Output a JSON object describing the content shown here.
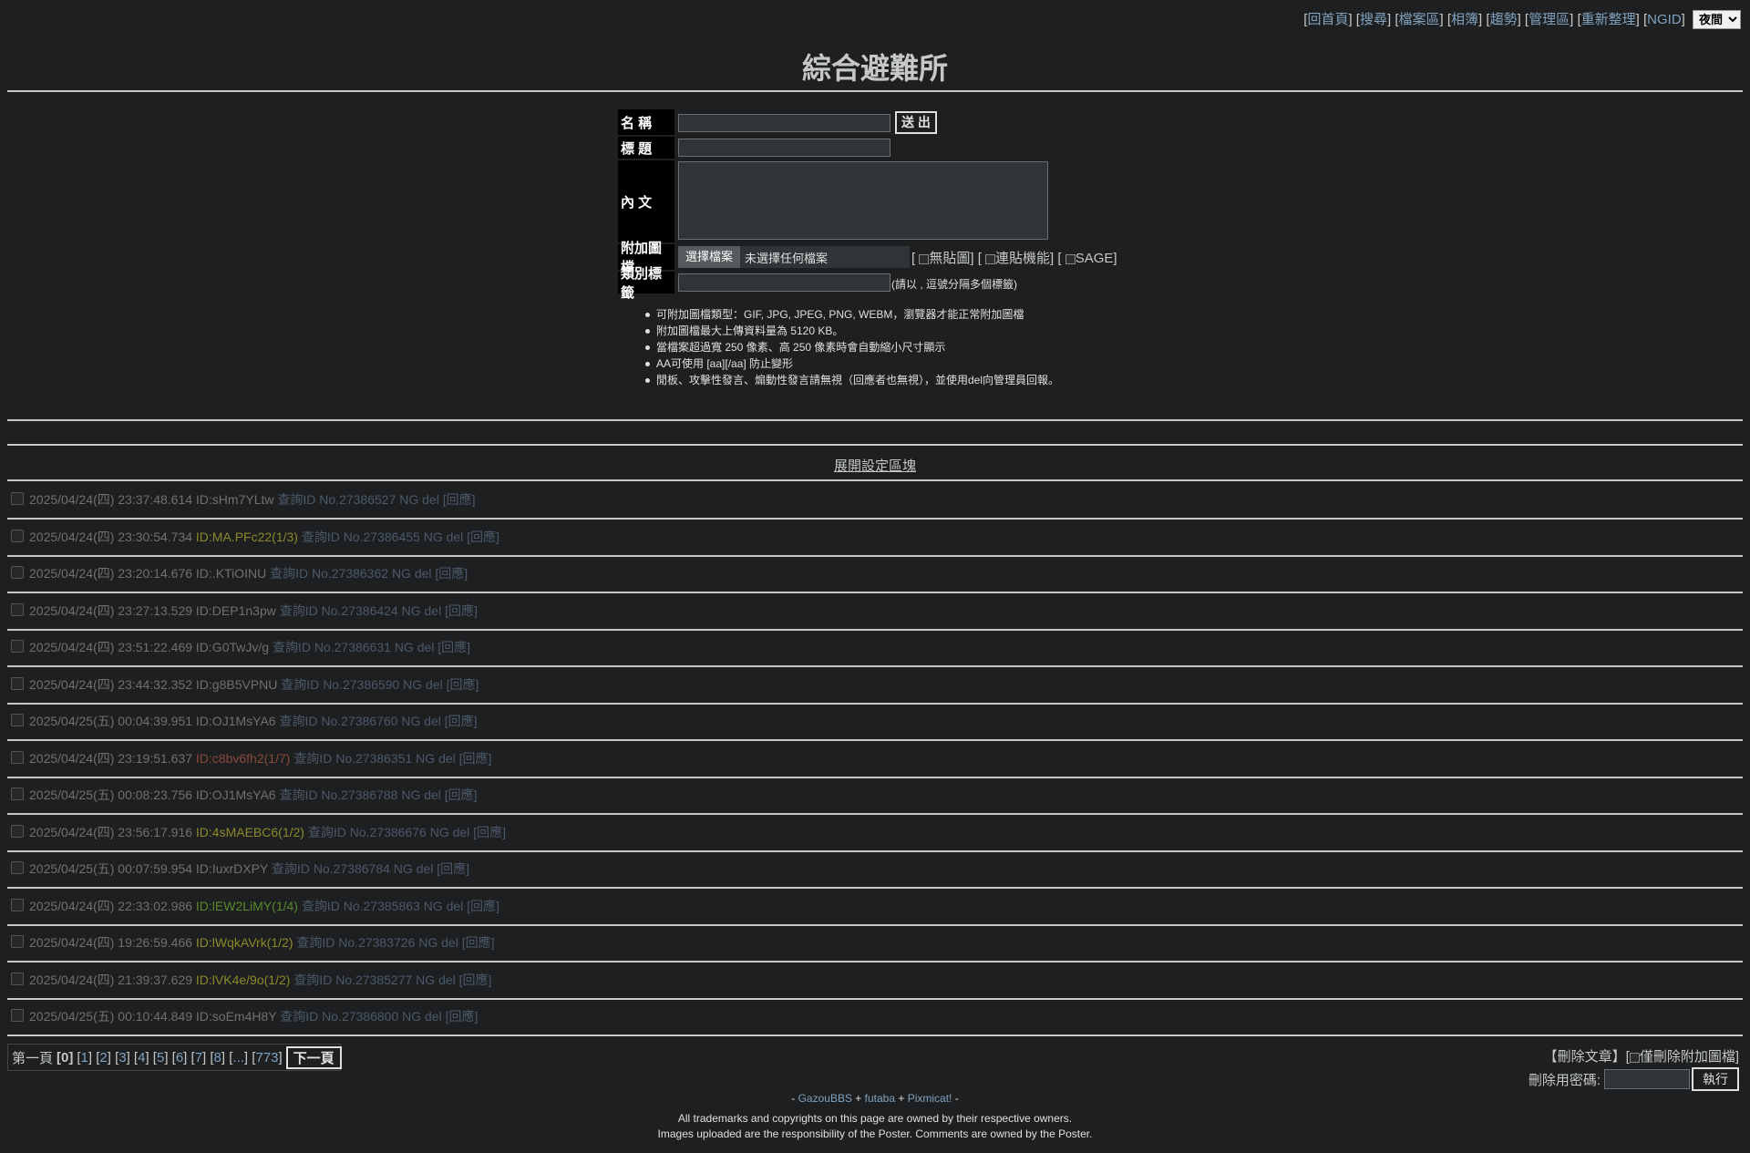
{
  "topnav": {
    "items": [
      "回首頁",
      "搜尋",
      "檔案區",
      "相簿",
      "趨勢",
      "管理區",
      "重新整理",
      "NGID"
    ],
    "mode": "夜間"
  },
  "title": "綜合避難所",
  "form": {
    "name_label": "名 稱",
    "subject_label": "標 題",
    "content_label": "內 文",
    "attach_label": "附加圖檔",
    "tag_label": "類別標籤",
    "submit": "送 出",
    "choose_file": "選擇檔案",
    "no_file": "未選擇任何檔案",
    "opt_noimg": "無貼圖",
    "opt_link": "連貼機能",
    "opt_sage": "SAGE",
    "tag_hint": "(請以 , 逗號分隔多個標籤)"
  },
  "rules": [
    "可附加圖檔類型：GIF, JPG, JPEG, PNG, WEBM，瀏覽器才能正常附加圖檔",
    "附加圖檔最大上傳資料量為 5120 KB。",
    "當檔案超過寬 250 像素、高 250 像素時會自動縮小尺寸顯示",
    "AA可使用 [aa][/aa] 防止變形",
    "閒板、攻擊性發言、煽動性發言請無視（回應者也無視），並使用del向管理員回報。"
  ],
  "expand_label": "展開設定區塊",
  "posts": [
    {
      "date": "2025/04/24(四) 23:37:48.614",
      "id": "ID:sHm7YLtw",
      "id_color": "#707070",
      "no": "No.27386527"
    },
    {
      "date": "2025/04/24(四) 23:30:54.734",
      "id": "ID:MA.PFc22(1/3)",
      "id_color": "#8c8a2a",
      "no": "No.27386455"
    },
    {
      "date": "2025/04/24(四) 23:20:14.676",
      "id": "ID:.KTiOINU",
      "id_color": "#707070",
      "no": "No.27386362"
    },
    {
      "date": "2025/04/24(四) 23:27:13.529",
      "id": "ID:DEP1n3pw",
      "id_color": "#707070",
      "no": "No.27386424"
    },
    {
      "date": "2025/04/24(四) 23:51:22.469",
      "id": "ID:G0TwJv/g",
      "id_color": "#707070",
      "no": "No.27386631"
    },
    {
      "date": "2025/04/24(四) 23:44:32.352",
      "id": "ID:g8B5VPNU",
      "id_color": "#707070",
      "no": "No.27386590"
    },
    {
      "date": "2025/04/25(五) 00:04:39.951",
      "id": "ID:OJ1MsYA6",
      "id_color": "#707070",
      "no": "No.27386760"
    },
    {
      "date": "2025/04/24(四) 23:19:51.637",
      "id": "ID:c8bv6fh2(1/7)",
      "id_color": "#8a4a3a",
      "no": "No.27386351"
    },
    {
      "date": "2025/04/25(五) 00:08:23.756",
      "id": "ID:OJ1MsYA6",
      "id_color": "#707070",
      "no": "No.27386788"
    },
    {
      "date": "2025/04/24(四) 23:56:17.916",
      "id": "ID:4sMAEBC6(1/2)",
      "id_color": "#8c8a2a",
      "no": "No.27386676"
    },
    {
      "date": "2025/04/25(五) 00:07:59.954",
      "id": "ID:IuxrDXPY",
      "id_color": "#707070",
      "no": "No.27386784"
    },
    {
      "date": "2025/04/24(四) 22:33:02.986",
      "id": "ID:lEW2LiMY(1/4)",
      "id_color": "#5a8a2a",
      "no": "No.27385863"
    },
    {
      "date": "2025/04/24(四) 19:26:59.466",
      "id": "ID:lWqkAVrk(1/2)",
      "id_color": "#8c8a2a",
      "no": "No.27383726"
    },
    {
      "date": "2025/04/24(四) 21:39:37.629",
      "id": "ID:lVK4e/9o(1/2)",
      "id_color": "#8c8a2a",
      "no": "No.27385277"
    },
    {
      "date": "2025/04/25(五) 00:10:44.849",
      "id": "ID:soEm4H8Y",
      "id_color": "#707070",
      "no": "No.27386800"
    }
  ],
  "post_labels": {
    "query": "查詢ID",
    "ng": "NG",
    "del": "del",
    "reply": "回應"
  },
  "pager": {
    "first": "第一頁",
    "current": "[0]",
    "pages": [
      "1",
      "2",
      "3",
      "4",
      "5",
      "6",
      "7",
      "8",
      "...",
      "773"
    ],
    "next": "下一頁"
  },
  "delete_box": {
    "title": "【刪除文章】",
    "only_img": "僅刪除附加圖檔",
    "pwd_label": "刪除用密碼:",
    "exec": "執行"
  },
  "footer": {
    "dash": "-",
    "gazou": "GazouBBS",
    "futaba": "futaba",
    "pixmicat": "Pixmicat!",
    "line1": "All trademarks and copyrights on this page are owned by their respective owners.",
    "line2": "Images uploaded are the responsibility of the Poster. Comments are owned by the Poster."
  }
}
